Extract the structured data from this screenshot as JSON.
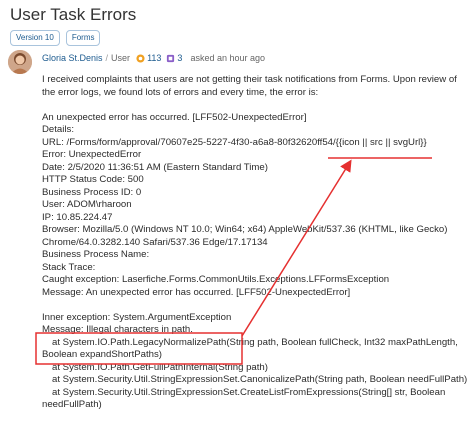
{
  "title": "User Task Errors",
  "tags": [
    "Version 10",
    "Forms"
  ],
  "author": {
    "name": "Gloria St.Denis",
    "separator": "/",
    "role": "User",
    "points": "113",
    "badges": "3",
    "asked": "asked an hour ago"
  },
  "body": {
    "intro": "I received complaints that users are not getting their task notifications from Forms. Upon review of the error logs, we found lots of errors and every time, the error is:",
    "error_lines": [
      "An unexpected error has occurred. [LFF502-UnexpectedError]",
      "Details:",
      "URL: /Forms/form/approval/70607e25-5227-4f30-a6a8-80f32620ff54/{{icon || src || svgUrl}}",
      "Error: UnexpectedError",
      "Date: 2/5/2020 11:36:51 AM (Eastern Standard Time)",
      "HTTP Status Code: 500",
      "Business Process ID: 0",
      "User: ADOM\\rharoon",
      "IP: 10.85.224.47",
      "Browser: Mozilla/5.0 (Windows NT 10.0; Win64; x64) AppleWebKit/537.36 (KHTML, like Gecko)",
      "Chrome/64.0.3282.140 Safari/537.36 Edge/17.17134",
      "Business Process Name:",
      "Stack Trace:",
      "Caught exception: Laserfiche.Forms.CommonUtils.Exceptions.LFFormsException",
      "Message: An unexpected error has occurred. [LFF502-UnexpectedError]"
    ],
    "inner_lines": [
      "Inner exception: System.ArgumentException",
      "Message: Illegal characters in path."
    ],
    "stack_lines": [
      "at System.IO.Path.LegacyNormalizePath(String path, Boolean fullCheck, Int32 maxPathLength,",
      "Boolean expandShortPaths)",
      "at System.IO.Path.GetFullPathInternal(String path)",
      "at System.Security.Util.StringExpressionSet.CanonicalizePath(String path, Boolean needFullPath)",
      "at System.Security.Util.StringExpressionSet.CreateListFromExpressions(String[] str, Boolean",
      "needFullPath)"
    ]
  },
  "colors": {
    "annotation": "#e53030",
    "link": "#1d5b8f",
    "text": "#2b2b2b"
  }
}
